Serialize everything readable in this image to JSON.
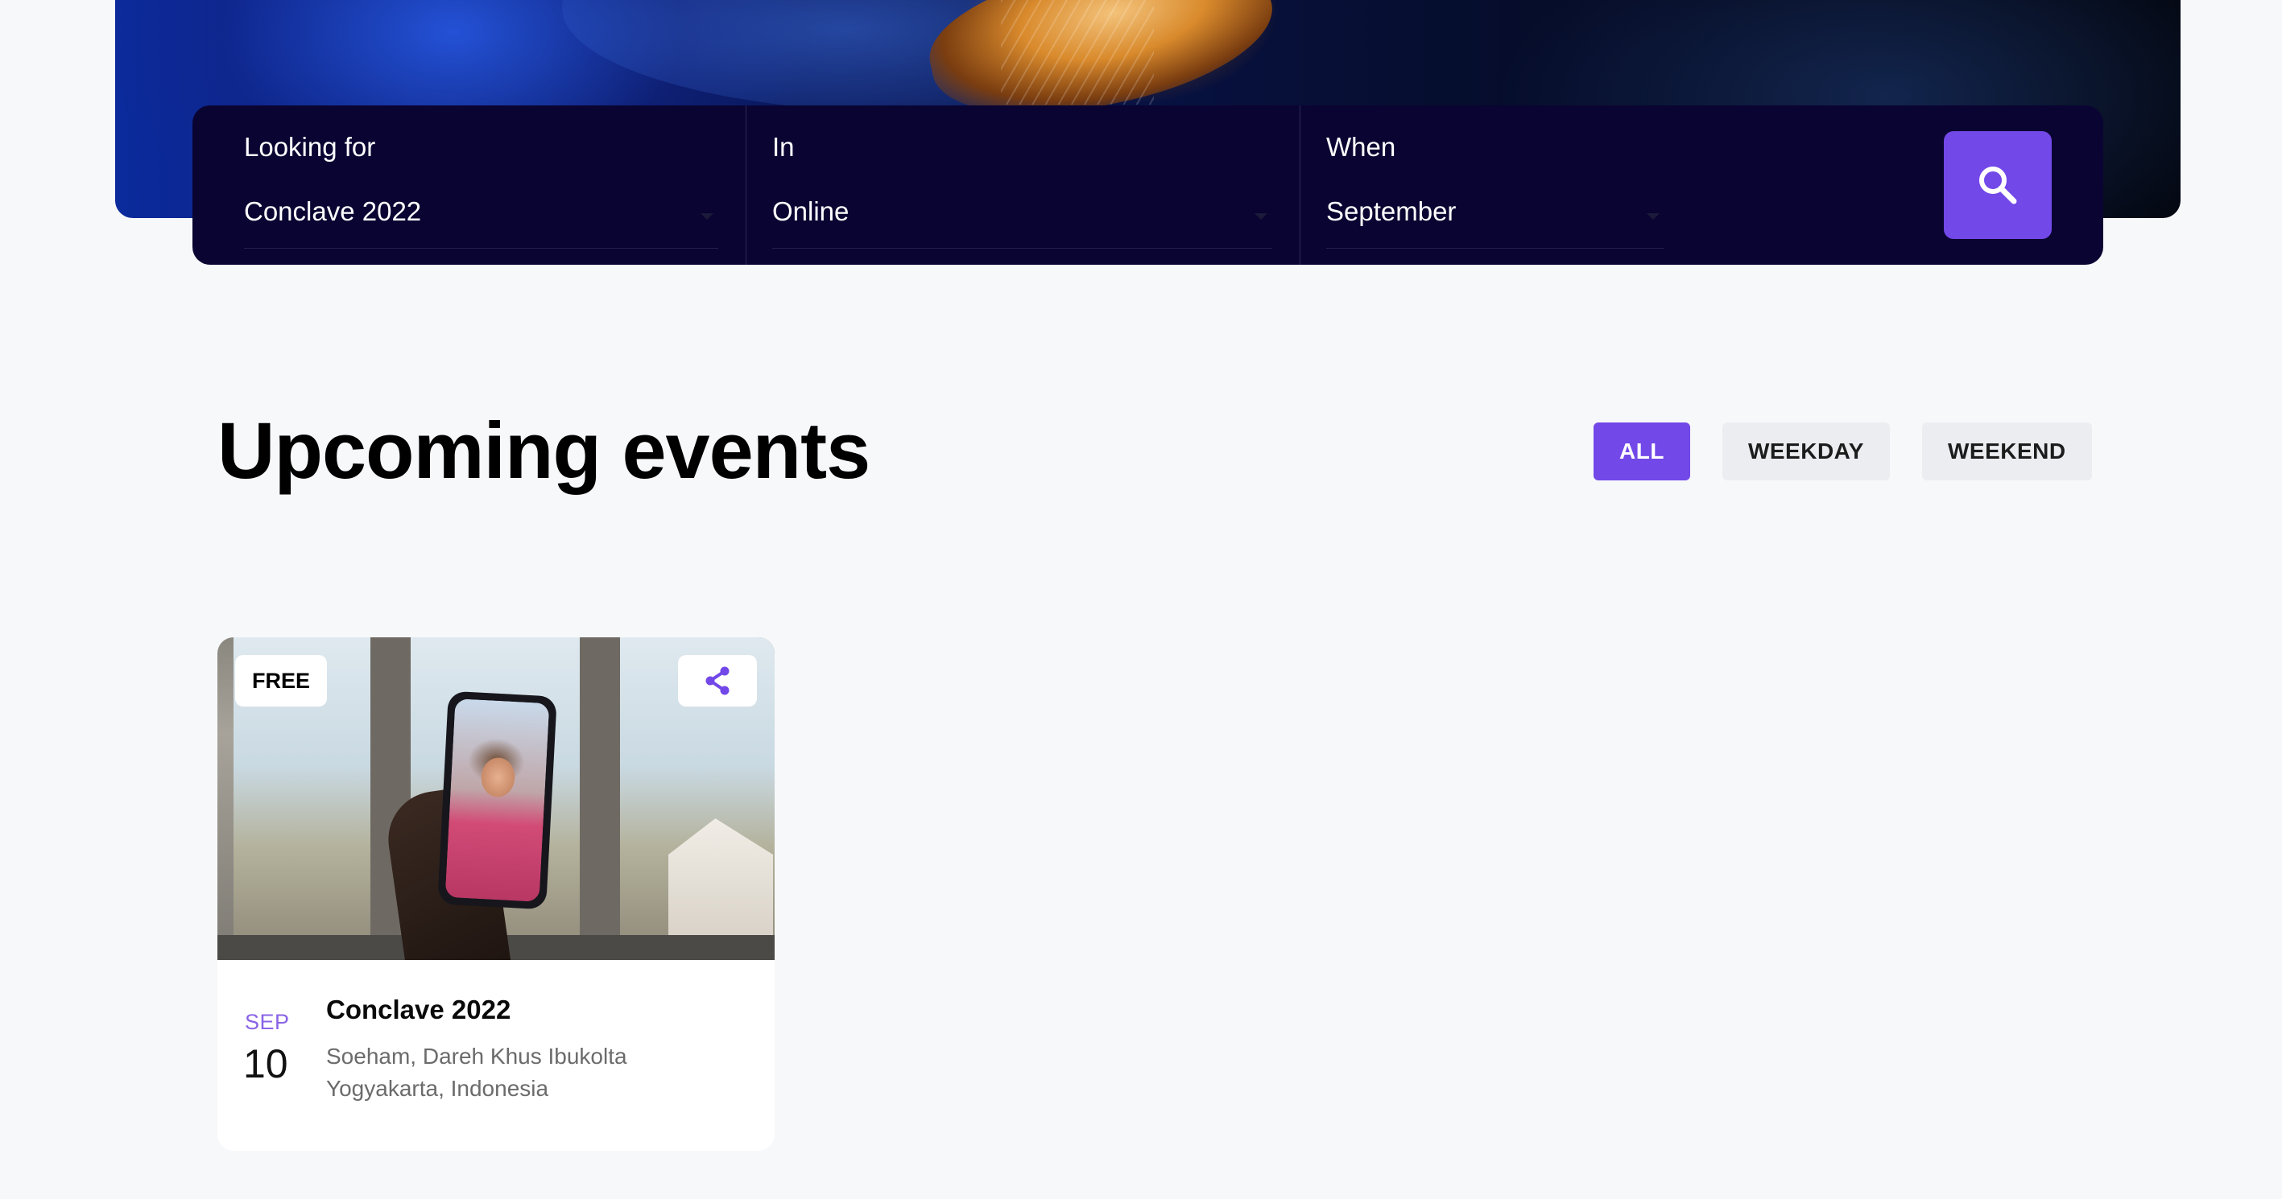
{
  "search": {
    "looking_for": {
      "label": "Looking for",
      "value": "Conclave 2022"
    },
    "in": {
      "label": "In",
      "value": "Online"
    },
    "when": {
      "label": "When",
      "value": "September"
    },
    "button_icon": "search-icon"
  },
  "section": {
    "title": "Upcoming events",
    "filters": [
      "ALL",
      "WEEKDAY",
      "WEEKEND"
    ],
    "active_filter": "ALL"
  },
  "events": [
    {
      "badge": "FREE",
      "share_icon": "share-icon",
      "month": "SEP",
      "day": "10",
      "title": "Conclave 2022",
      "location_line1": "Soeham, Dareh Khus Ibukolta",
      "location_line2": "Yogyakarta, Indonesia"
    }
  ],
  "colors": {
    "accent": "#7248e8",
    "search_bar_bg": "#0a0432",
    "page_bg": "#f7f8fa",
    "month_text": "#8a63e6"
  }
}
